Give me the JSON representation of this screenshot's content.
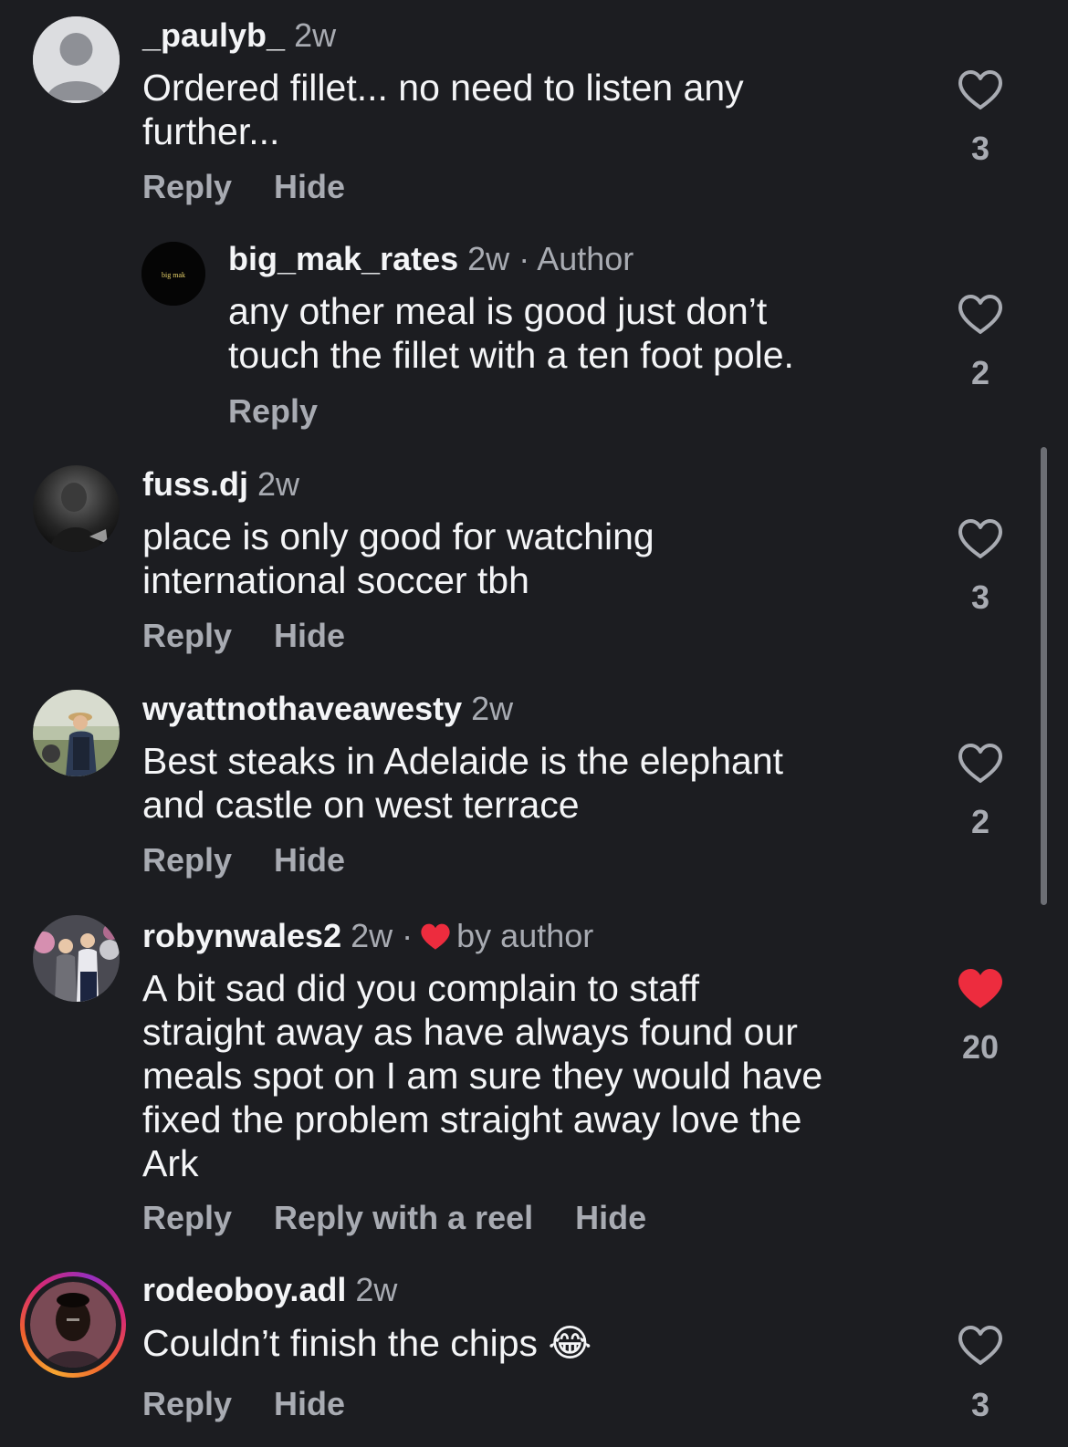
{
  "comments": [
    {
      "username": "_paulyb_",
      "time": "2w",
      "text": "Ordered fillet... no need to listen any\nfurther...",
      "actions": [
        "Reply",
        "Hide"
      ],
      "likes": "3",
      "liked": false,
      "avatar": "default-avatar"
    },
    {
      "username": "big_mak_rates",
      "time": "2w",
      "meta_suffix": "· Author",
      "text": "any other meal is good just don’t\ntouch the fillet with a ten foot pole.",
      "actions": [
        "Reply"
      ],
      "likes": "2",
      "liked": false,
      "avatar_text": "big mak"
    },
    {
      "username": "fuss.dj",
      "time": "2w",
      "text": "place is only good for watching\ninternational soccer tbh",
      "actions": [
        "Reply",
        "Hide"
      ],
      "likes": "3",
      "liked": false
    },
    {
      "username": "wyattnothaveawesty",
      "time": "2w",
      "text": "Best steaks in Adelaide is the elephant\nand castle on west terrace",
      "actions": [
        "Reply",
        "Hide"
      ],
      "likes": "2",
      "liked": false
    },
    {
      "username": "robynwales2",
      "time": "2w",
      "meta_separator": "·",
      "meta_suffix": "by author",
      "text": "A bit sad did you complain to staff\nstraight away as have always found our\nmeals spot on  I am sure they would have\nfixed the problem straight away love the\nArk",
      "actions": [
        "Reply",
        "Reply with a reel",
        "Hide"
      ],
      "likes": "20",
      "liked": true
    },
    {
      "username": "rodeoboy.adl",
      "time": "2w",
      "text": "Couldn’t finish the chips 😂",
      "actions": [
        "Reply",
        "Hide"
      ],
      "likes": "3",
      "liked": false,
      "story_ring": true
    }
  ],
  "colors": {
    "background": "#1c1d21",
    "text": "#f4f5f7",
    "muted": "#a8abb2",
    "like_red": "#ed2c3e"
  }
}
